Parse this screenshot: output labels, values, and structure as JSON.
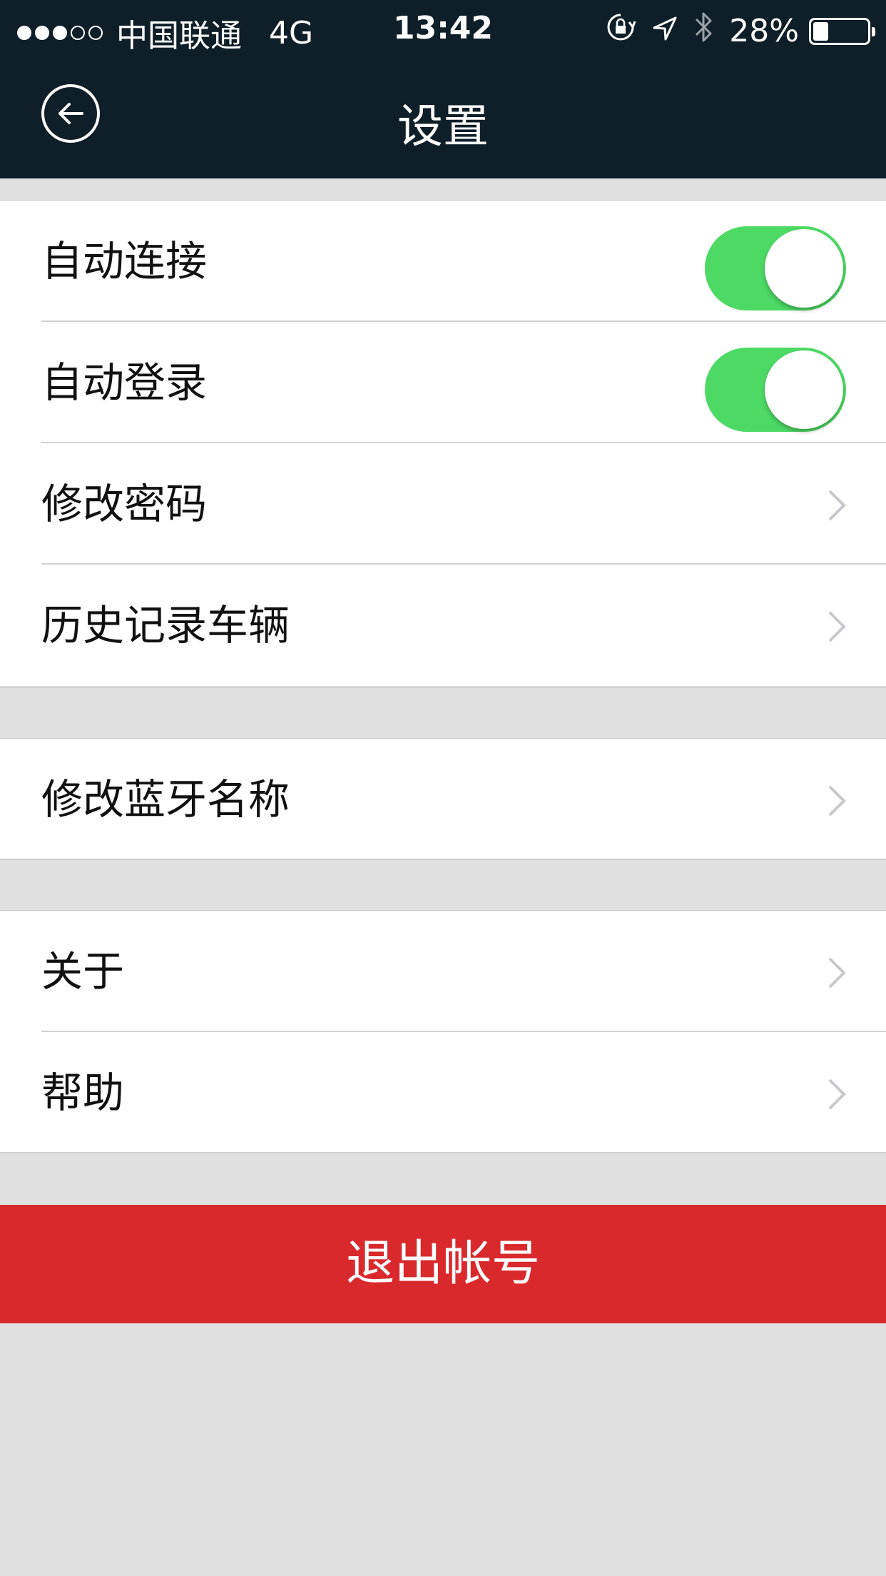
{
  "status_bar": {
    "carrier": "中国联通",
    "network": "4G",
    "time": "13:42",
    "battery": "28%",
    "battery_level": 0.28,
    "signal_bars": 3,
    "icons": [
      "orientation-lock-icon",
      "location-icon",
      "bluetooth-icon",
      "battery-icon"
    ]
  },
  "header": {
    "title": "设置",
    "back_icon": "back-arrow-circle-icon",
    "background": "#0e1f2a"
  },
  "settings": {
    "auto_connect": {
      "label": "自动连接",
      "enabled": true
    },
    "auto_login": {
      "label": "自动登录",
      "enabled": true
    },
    "change_password": {
      "label": "修改密码"
    },
    "history_vehicles": {
      "label": "历史记录车辆"
    },
    "bluetooth_name": {
      "label": "修改蓝牙名称"
    },
    "about": {
      "label": "关于"
    },
    "help": {
      "label": "帮助"
    }
  },
  "logout": {
    "label": "退出帐号",
    "color": "#d9292c"
  },
  "colors": {
    "toggle_on": "#4cd964",
    "background": "#e0e0e0"
  }
}
